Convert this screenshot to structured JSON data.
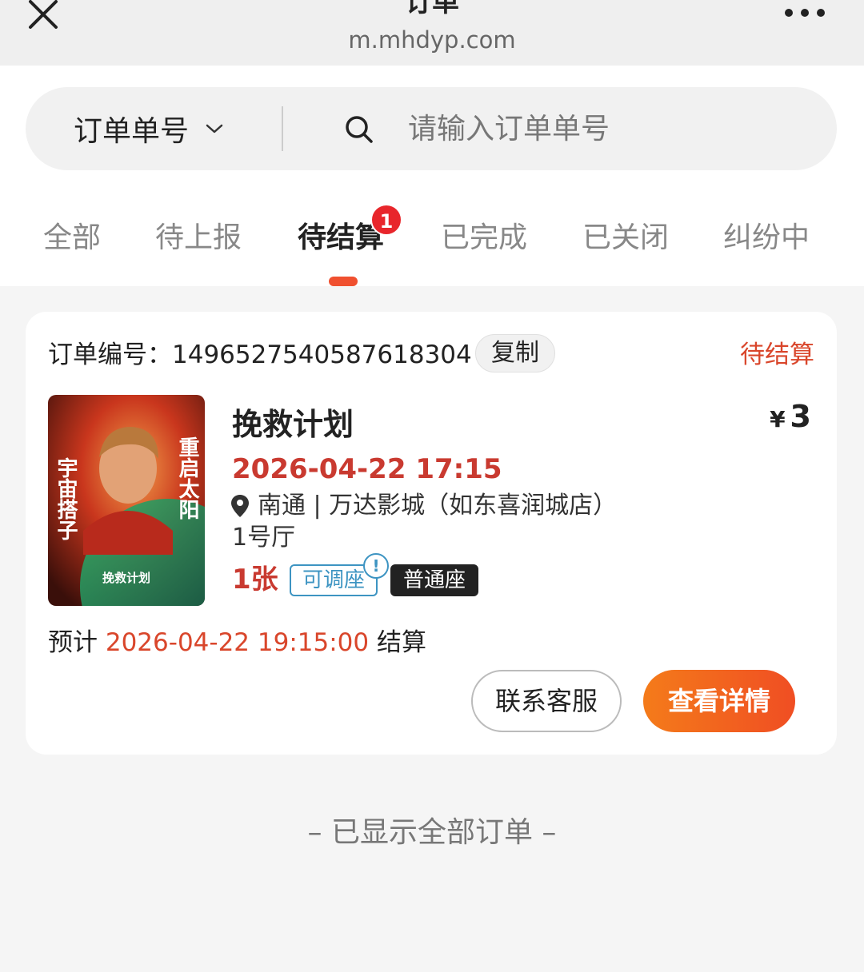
{
  "header": {
    "title": "订单",
    "url": "m.mhdyp.com",
    "close_icon": "close-icon",
    "more_icon": "more-icon"
  },
  "search": {
    "type_label": "订单单号",
    "placeholder": "请输入订单单号",
    "value": ""
  },
  "tabs": {
    "items": [
      {
        "label": "全部"
      },
      {
        "label": "待上报"
      },
      {
        "label": "待结算",
        "badge": "1"
      },
      {
        "label": "已完成"
      },
      {
        "label": "已关闭"
      },
      {
        "label": "纠纷中"
      }
    ],
    "active": 2
  },
  "order": {
    "number_label": "订单编号：1496527540587618304",
    "copy_label": "复制",
    "status": "待结算",
    "poster": {
      "left_text": "宇宙搭子",
      "right_text": "重启太阳",
      "bottom_text": "挽救计划"
    },
    "movie_title": "挽救计划",
    "currency": "¥",
    "price": "3",
    "showtime": "2026-04-22 17:15",
    "location": "南通 | 万达影城（如东喜润城店）",
    "hall": "1号厅",
    "tickets": "1张",
    "seat_adjust": "可调座",
    "info_mark": "!",
    "seat_type": "普通座",
    "settle_prefix": "预计",
    "settle_time": "2026-04-22 19:15:00",
    "settle_suffix": "结算",
    "contact_label": "联系客服",
    "detail_label": "查看详情"
  },
  "footer": {
    "note": "– 已显示全部订单 –"
  },
  "colors": {
    "accent": "#f04e23",
    "status_red": "#d9462b",
    "seat_blue": "#3d94c2"
  }
}
